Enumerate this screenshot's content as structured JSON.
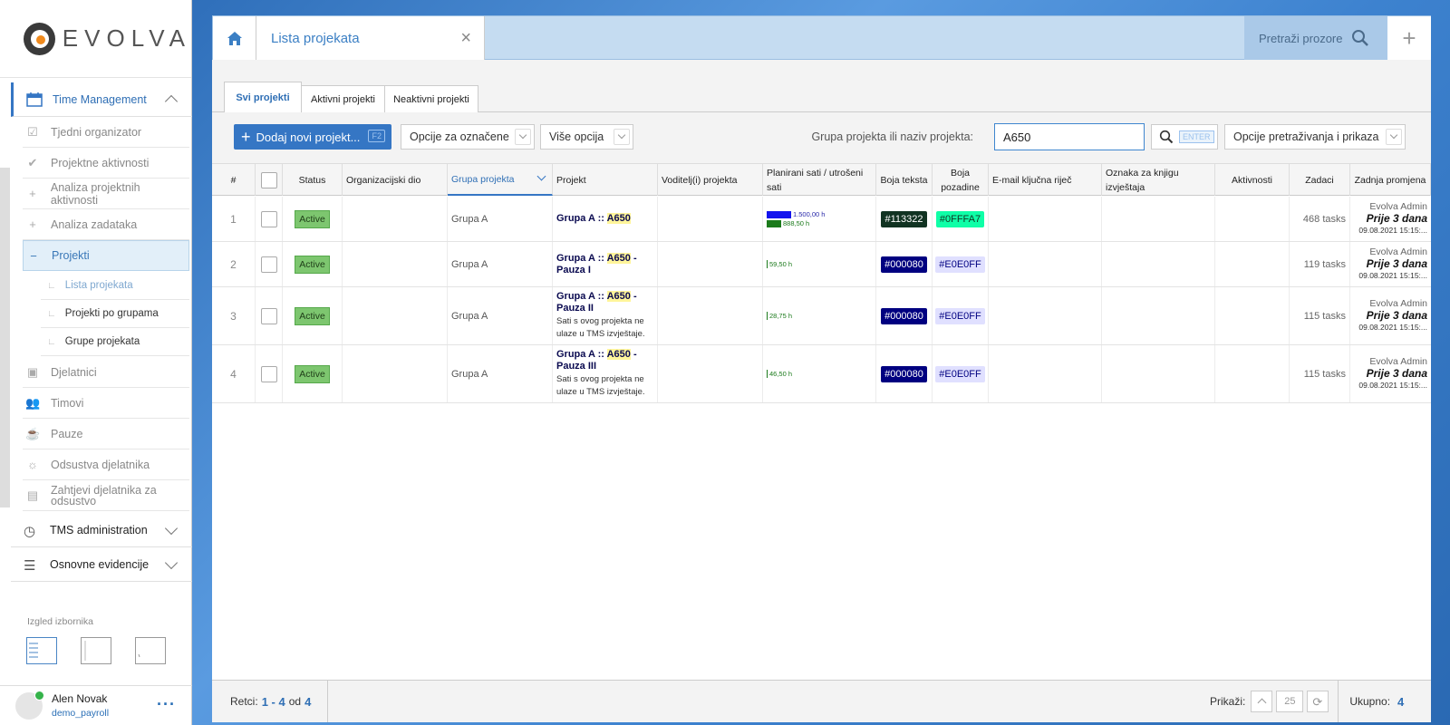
{
  "brand": {
    "name": "EVOLVA"
  },
  "sidebar": {
    "sections": [
      {
        "label": "Time Management"
      },
      {
        "label": "TMS administration"
      },
      {
        "label": "Osnovne evidencije"
      }
    ],
    "items": [
      {
        "label": "Tjedni organizator",
        "icon": "calendar-check-icon"
      },
      {
        "label": "Projektne aktivnosti",
        "icon": "check-icon"
      },
      {
        "label": "Analiza projektnih aktivnosti",
        "icon": "plus-icon"
      },
      {
        "label": "Analiza zadataka",
        "icon": "plus-icon"
      },
      {
        "label": "Projekti",
        "icon": "minus-icon"
      },
      {
        "label": "Djelatnici",
        "icon": "id-card-icon"
      },
      {
        "label": "Timovi",
        "icon": "users-icon"
      },
      {
        "label": "Pauze",
        "icon": "coffee-icon"
      },
      {
        "label": "Odsustva djelatnika",
        "icon": "sun-icon"
      },
      {
        "label": "Zahtjevi djelatnika za odsustvo",
        "icon": "request-icon"
      }
    ],
    "sub_items": [
      {
        "label": "Lista projekata"
      },
      {
        "label": "Projekti po grupama"
      },
      {
        "label": "Grupe projekata"
      }
    ],
    "layout_label": "Izgled izbornika"
  },
  "user": {
    "name": "Alen Novak",
    "account": "demo_payroll"
  },
  "window": {
    "tab_title": "Lista projekata",
    "search_windows": "Pretraži prozore",
    "subtabs": [
      "Svi projekti",
      "Aktivni projekti",
      "Neaktivni projekti"
    ]
  },
  "toolbar": {
    "add_label": "Dodaj novi projekt...",
    "add_shortcut": "F2",
    "opcije_oznacene": "Opcije za označene",
    "vise_opcija": "Više opcija",
    "search_label": "Grupa projekta ili naziv projekta:",
    "search_value": "A650",
    "enter_hint": "ENTER",
    "search_options": "Opcije pretraživanja i prikaza"
  },
  "table": {
    "columns": [
      "#",
      "",
      "Status",
      "Organizacijski dio",
      "Grupa projekta",
      "Projekt",
      "Voditelj(i) projekta",
      "Planirani sati / utrošeni sati",
      "Boja teksta",
      "Boja pozadine",
      "E-mail ključna riječ",
      "Oznaka za knjigu izvještaja",
      "Aktivnosti",
      "Zadaci",
      "Zadnja promjena"
    ],
    "rows": [
      {
        "num": "1",
        "status": "Active",
        "group": "Grupa A",
        "proj_prefix": "Grupa A :: ",
        "proj_hl": "A650",
        "proj_suffix": "",
        "note": "",
        "planned": "1.500,00 h",
        "planned_frac": 1.0,
        "spent": "888,50 h",
        "spent_frac": 0.59,
        "text_color": "#113322",
        "bg_color": "#0FFFA7",
        "tasks": "468 tasks",
        "changed_by": "Evolva Admin",
        "changed_rel": "Prije 3 dana",
        "changed_date": "09.08.2021 15:15:..."
      },
      {
        "num": "2",
        "status": "Active",
        "group": "Grupa A",
        "proj_prefix": "Grupa A :: ",
        "proj_hl": "A650",
        "proj_suffix": " - Pauza I",
        "note": "",
        "planned": "",
        "spent": "59,50 h",
        "spent_frac": 0.0,
        "text_color": "#000080",
        "bg_color": "#E0E0FF",
        "tasks": "119 tasks",
        "changed_by": "Evolva Admin",
        "changed_rel": "Prije 3 dana",
        "changed_date": "09.08.2021 15:15:..."
      },
      {
        "num": "3",
        "status": "Active",
        "group": "Grupa A",
        "proj_prefix": "Grupa A :: ",
        "proj_hl": "A650",
        "proj_suffix": " - Pauza II",
        "note": "Sati s ovog projekta ne ulaze u TMS izvještaje.",
        "planned": "",
        "spent": "28,75 h",
        "spent_frac": 0.0,
        "text_color": "#000080",
        "bg_color": "#E0E0FF",
        "tasks": "115 tasks",
        "changed_by": "Evolva Admin",
        "changed_rel": "Prije 3 dana",
        "changed_date": "09.08.2021 15:15:..."
      },
      {
        "num": "4",
        "status": "Active",
        "group": "Grupa A",
        "proj_prefix": "Grupa A :: ",
        "proj_hl": "A650",
        "proj_suffix": " - Pauza III",
        "note": "Sati s ovog projekta ne ulaze u TMS izvještaje.",
        "planned": "",
        "spent": "46,50 h",
        "spent_frac": 0.0,
        "text_color": "#000080",
        "bg_color": "#E0E0FF",
        "tasks": "115 tasks",
        "changed_by": "Evolva Admin",
        "changed_rel": "Prije 3 dana",
        "changed_date": "09.08.2021 15:15:..."
      }
    ]
  },
  "footer": {
    "retci_label": "Retci:",
    "range": "1 - 4",
    "od_label": "od",
    "total_rows": "4",
    "prikazi_label": "Prikaži:",
    "page_size": "25",
    "ukupno_label": "Ukupno:",
    "ukupno_value": "4"
  },
  "colors": {
    "accent": "#3576c4",
    "active_badge": "#7dc66f"
  }
}
